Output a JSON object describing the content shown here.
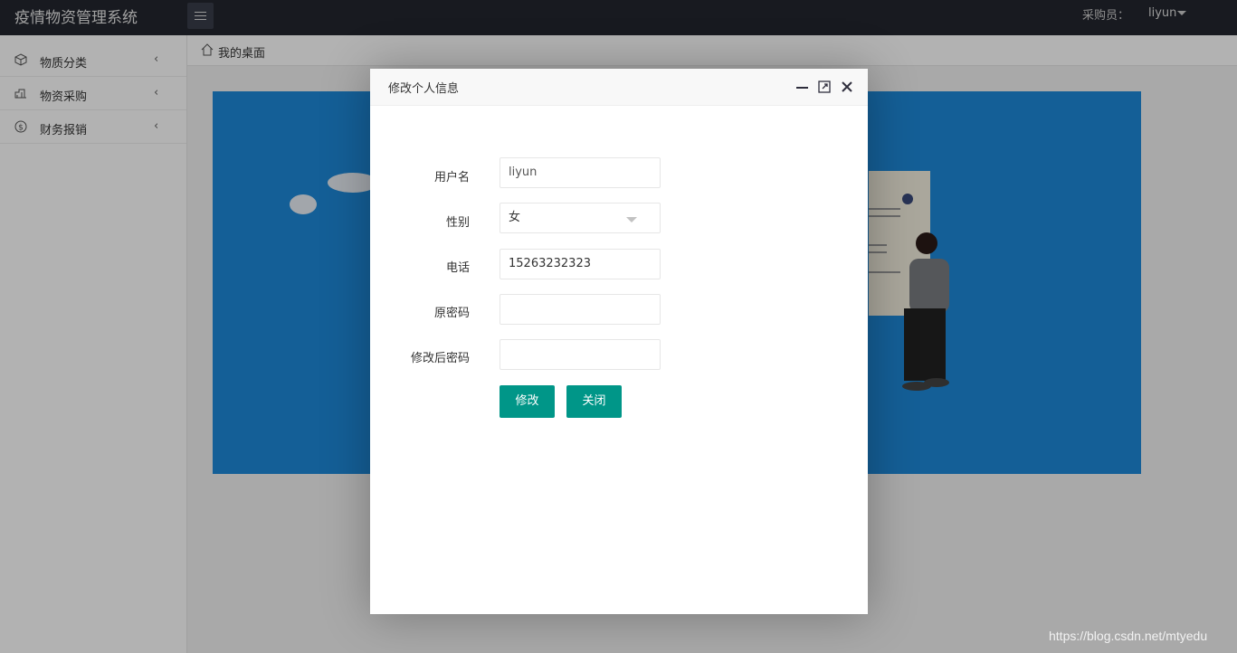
{
  "header": {
    "app_title": "疫情物资管理系统",
    "role_label": "采购员：",
    "user_name": "liyun"
  },
  "sidebar": {
    "items": [
      {
        "label": "物质分类",
        "icon": "cube-icon"
      },
      {
        "label": "物资采购",
        "icon": "cart-icon"
      },
      {
        "label": "财务报销",
        "icon": "dollar-icon"
      }
    ]
  },
  "tabbar": {
    "home_tab": "我的桌面"
  },
  "modal": {
    "title": "修改个人信息",
    "fields": {
      "username": {
        "label": "用户名",
        "value": "liyun"
      },
      "gender": {
        "label": "性别",
        "value": "女"
      },
      "phone": {
        "label": "电话",
        "value": "15263232323"
      },
      "old_password": {
        "label": "原密码",
        "value": ""
      },
      "new_password": {
        "label": "修改后密码",
        "value": ""
      }
    },
    "submit_label": "修改",
    "close_label": "关闭"
  },
  "colors": {
    "primary_button": "#009688",
    "topbar": "#23262e",
    "banner": "#1e88d8"
  },
  "watermark": "https://blog.csdn.net/mtyedu"
}
